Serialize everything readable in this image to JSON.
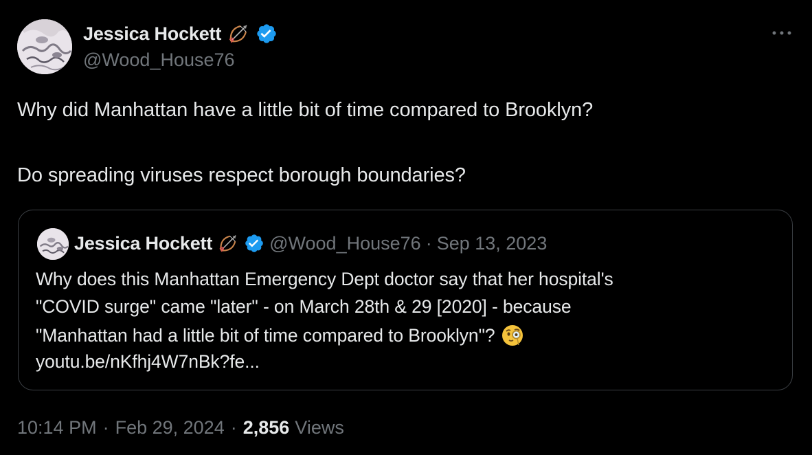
{
  "author": {
    "display_name": "Jessica Hockett",
    "handle": "@Wood_House76",
    "avatar_icon": "avatar-photo",
    "badge_emoji": "bow-and-arrow-icon",
    "verified_icon": "verified-badge-icon",
    "verified_color": "#1d9bf0"
  },
  "menu": {
    "more_icon": "more-icon"
  },
  "tweet": {
    "lines": [
      "Why did Manhattan have a little bit of time compared to Brooklyn?",
      "Do spreading viruses respect borough boundaries?"
    ]
  },
  "quote": {
    "display_name": "Jessica Hockett",
    "handle": "@Wood_House76",
    "separator": "·",
    "date": "Sep 13, 2023",
    "lines": [
      "Why does this Manhattan Emergency Dept doctor say that her hospital's",
      "\"COVID surge\" came \"later\" - on March 28th & 29 [2020] - because",
      "\"Manhattan had a little bit of time compared to Brooklyn\"?",
      "youtu.be/nKfhj4W7nBk?fe..."
    ],
    "emoji": "face-with-monocle-icon"
  },
  "footer": {
    "time": "10:14 PM",
    "separator": "·",
    "date": "Feb 29, 2024",
    "views_count": "2,856",
    "views_label": "Views"
  },
  "colors": {
    "background": "#000000",
    "text": "#e7e9ea",
    "secondary": "#71767b",
    "border": "#3c4045",
    "accent": "#1d9bf0"
  }
}
